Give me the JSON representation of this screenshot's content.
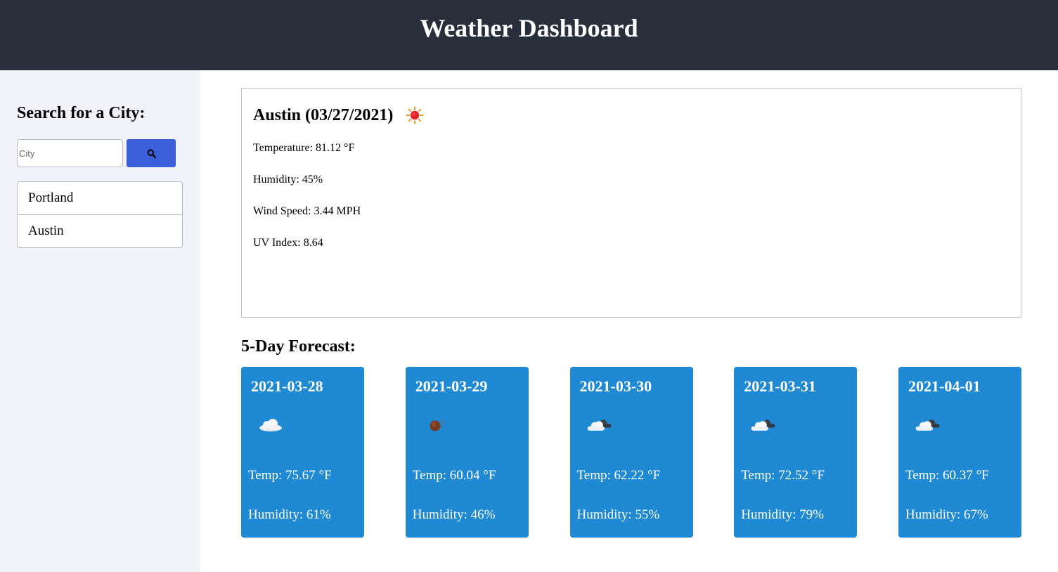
{
  "header": {
    "title": "Weather Dashboard"
  },
  "sidebar": {
    "heading": "Search for a City:",
    "search": {
      "placeholder": "City",
      "value": "",
      "button_icon": "search-icon"
    },
    "history": [
      {
        "label": "Portland"
      },
      {
        "label": "Austin"
      }
    ]
  },
  "current": {
    "title": "Austin (03/27/2021)",
    "icon": "sun-icon",
    "temperature": "Temperature: 81.12 °F",
    "humidity": "Humidity: 45%",
    "wind": "Wind Speed: 3.44 MPH",
    "uv": "UV Index: 8.64"
  },
  "forecast": {
    "heading": "5-Day Forecast:",
    "days": [
      {
        "date": "2021-03-28",
        "icon": "cloud-icon",
        "temp": "Temp: 75.67 °F",
        "humidity": "Humidity: 61%"
      },
      {
        "date": "2021-03-29",
        "icon": "night-sky-icon",
        "temp": "Temp: 60.04 °F",
        "humidity": "Humidity: 46%"
      },
      {
        "date": "2021-03-30",
        "icon": "broken-clouds-icon",
        "temp": "Temp: 62.22 °F",
        "humidity": "Humidity: 55%"
      },
      {
        "date": "2021-03-31",
        "icon": "broken-clouds-icon",
        "temp": "Temp: 72.52 °F",
        "humidity": "Humidity: 79%"
      },
      {
        "date": "2021-04-01",
        "icon": "broken-clouds-icon",
        "temp": "Temp: 60.37 °F",
        "humidity": "Humidity: 67%"
      }
    ]
  },
  "colors": {
    "header_bg": "#282e3a",
    "sidebar_bg": "#f2f3f8",
    "search_button": "#3a5fd8",
    "card_bg": "#2089d3"
  }
}
